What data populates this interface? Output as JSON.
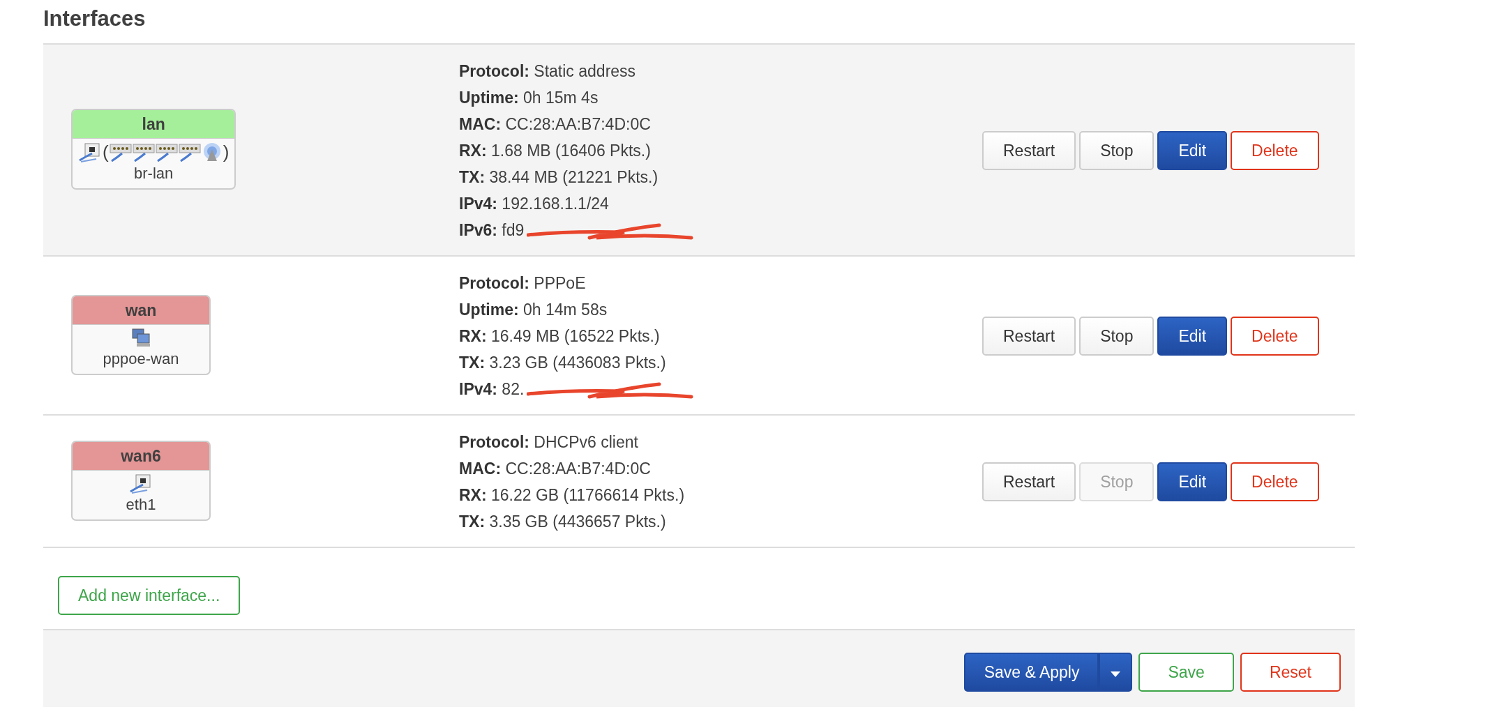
{
  "title": "Interfaces",
  "interfaces": [
    {
      "name": "lan",
      "color": "#a5ef9a",
      "shaded": true,
      "devices": [
        {
          "kind": "ethernet"
        },
        {
          "kind": "text",
          "text": "("
        },
        {
          "kind": "switch"
        },
        {
          "kind": "switch"
        },
        {
          "kind": "switch"
        },
        {
          "kind": "switch"
        },
        {
          "kind": "wireless"
        },
        {
          "kind": "text",
          "text": ")"
        }
      ],
      "device_name": "br-lan",
      "info": [
        {
          "label": "Protocol:",
          "value": "Static address",
          "redacted": false
        },
        {
          "label": "Uptime:",
          "value": "0h 15m 4s",
          "redacted": false
        },
        {
          "label": "MAC:",
          "value": "CC:28:AA:B7:4D:0C",
          "redacted": false
        },
        {
          "label": "RX:",
          "value": "1.68 MB (16406 Pkts.)",
          "redacted": false
        },
        {
          "label": "TX:",
          "value": "38.44 MB (21221 Pkts.)",
          "redacted": false
        },
        {
          "label": "IPv4:",
          "value": "192.168.1.1/24",
          "redacted": false
        },
        {
          "label": "IPv6:",
          "value": "fd9",
          "redacted": true
        }
      ],
      "buttons": [
        {
          "label": "Restart",
          "kind": "default",
          "disabled": false
        },
        {
          "label": "Stop",
          "kind": "default",
          "disabled": false
        },
        {
          "label": "Edit",
          "kind": "primary",
          "disabled": false
        },
        {
          "label": "Delete",
          "kind": "negative",
          "disabled": false
        }
      ]
    },
    {
      "name": "wan",
      "color": "#e49595",
      "shaded": false,
      "devices": [
        {
          "kind": "tunnel"
        }
      ],
      "device_name": "pppoe-wan",
      "info": [
        {
          "label": "Protocol:",
          "value": "PPPoE",
          "redacted": false
        },
        {
          "label": "Uptime:",
          "value": "0h 14m 58s",
          "redacted": false
        },
        {
          "label": "RX:",
          "value": "16.49 MB (16522 Pkts.)",
          "redacted": false
        },
        {
          "label": "TX:",
          "value": "3.23 GB (4436083 Pkts.)",
          "redacted": false
        },
        {
          "label": "IPv4:",
          "value": "82.",
          "redacted": true
        }
      ],
      "buttons": [
        {
          "label": "Restart",
          "kind": "default",
          "disabled": false
        },
        {
          "label": "Stop",
          "kind": "default",
          "disabled": false
        },
        {
          "label": "Edit",
          "kind": "primary",
          "disabled": false
        },
        {
          "label": "Delete",
          "kind": "negative",
          "disabled": false
        }
      ]
    },
    {
      "name": "wan6",
      "color": "#e49595",
      "shaded": false,
      "devices": [
        {
          "kind": "ethernet"
        }
      ],
      "device_name": "eth1",
      "info": [
        {
          "label": "Protocol:",
          "value": "DHCPv6 client",
          "redacted": false
        },
        {
          "label": "MAC:",
          "value": "CC:28:AA:B7:4D:0C",
          "redacted": false
        },
        {
          "label": "RX:",
          "value": "16.22 GB (11766614 Pkts.)",
          "redacted": false
        },
        {
          "label": "TX:",
          "value": "3.35 GB (4436657 Pkts.)",
          "redacted": false
        }
      ],
      "buttons": [
        {
          "label": "Restart",
          "kind": "default",
          "disabled": false
        },
        {
          "label": "Stop",
          "kind": "default",
          "disabled": true
        },
        {
          "label": "Edit",
          "kind": "primary",
          "disabled": false
        },
        {
          "label": "Delete",
          "kind": "negative",
          "disabled": false
        }
      ]
    }
  ],
  "add_button": "Add new interface...",
  "footer_buttons": [
    {
      "label": "Save & Apply",
      "kind": "split"
    },
    {
      "label": "Save",
      "kind": "positive"
    },
    {
      "label": "Reset",
      "kind": "negative"
    }
  ]
}
